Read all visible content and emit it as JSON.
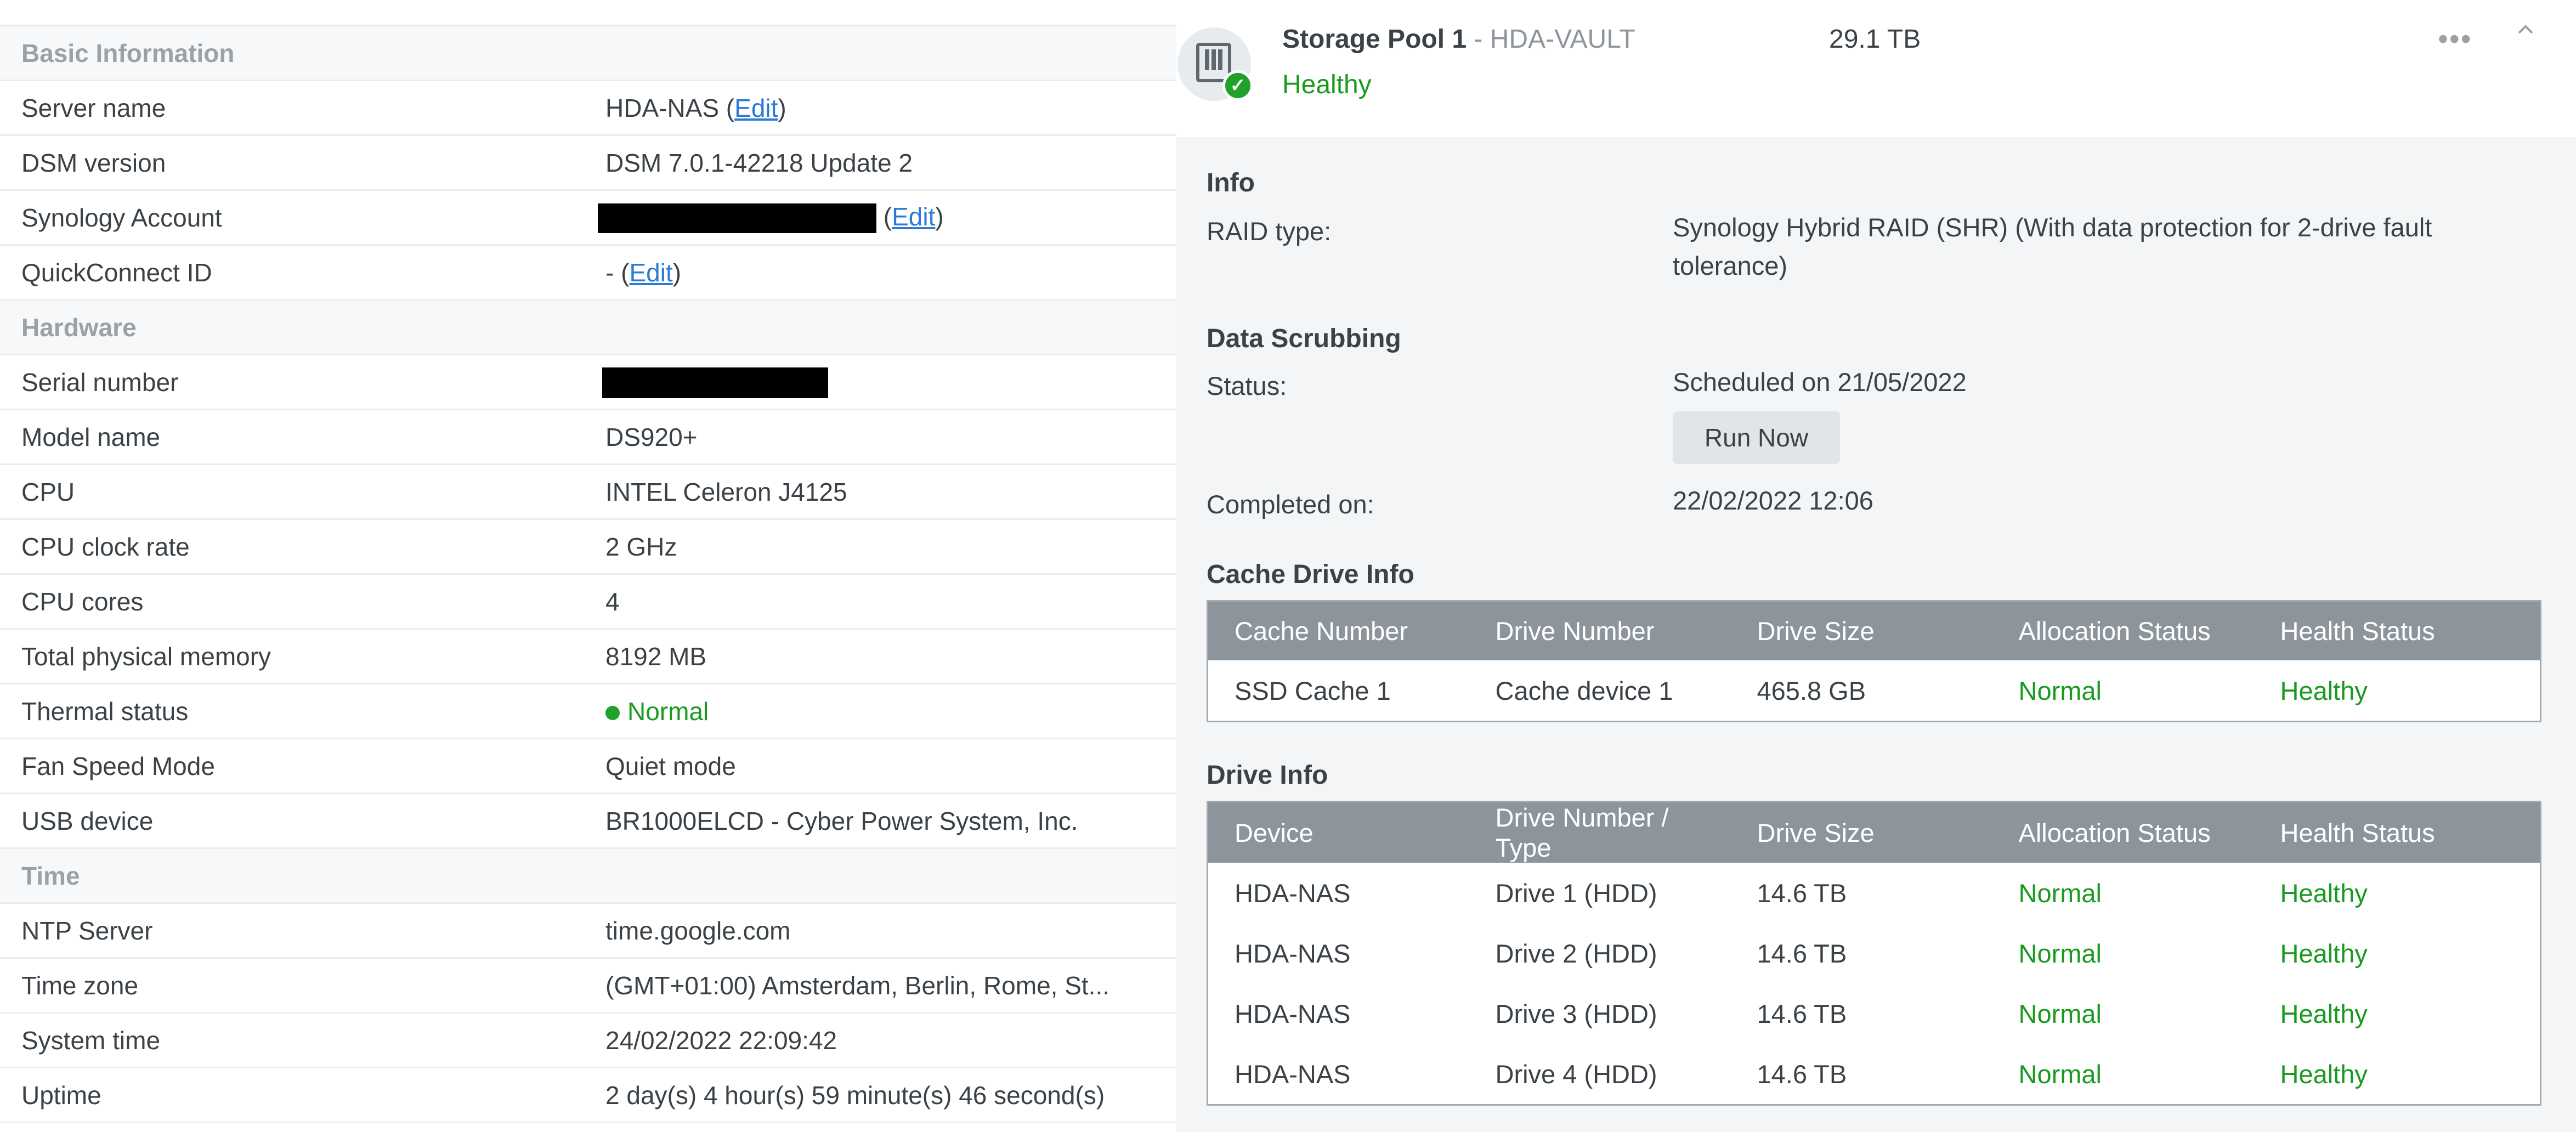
{
  "left_panel": {
    "sections": {
      "basic": "Basic Information",
      "hardware": "Hardware",
      "time": "Time"
    },
    "rows": {
      "server_name": {
        "label": "Server name",
        "value": "HDA-NAS",
        "edit": "Edit"
      },
      "dsm_version": {
        "label": "DSM version",
        "value": "DSM 7.0.1-42218 Update 2"
      },
      "synology_account": {
        "label": "Synology Account",
        "edit": "Edit"
      },
      "quickconnect": {
        "label": "QuickConnect ID",
        "value": "-",
        "edit": "Edit"
      },
      "serial": {
        "label": "Serial number"
      },
      "model": {
        "label": "Model name",
        "value": "DS920+"
      },
      "cpu": {
        "label": "CPU",
        "value": "INTEL Celeron J4125"
      },
      "cpu_clock": {
        "label": "CPU clock rate",
        "value": "2 GHz"
      },
      "cpu_cores": {
        "label": "CPU cores",
        "value": "4"
      },
      "memory": {
        "label": "Total physical memory",
        "value": "8192 MB"
      },
      "thermal": {
        "label": "Thermal status",
        "value": "Normal"
      },
      "fan": {
        "label": "Fan Speed Mode",
        "value": "Quiet mode"
      },
      "usb": {
        "label": "USB device",
        "value": "BR1000ELCD - Cyber Power System, Inc."
      },
      "ntp": {
        "label": "NTP Server",
        "value": "time.google.com"
      },
      "timezone": {
        "label": "Time zone",
        "value": "(GMT+01:00) Amsterdam, Berlin, Rome, St..."
      },
      "system_time": {
        "label": "System time",
        "value": "24/02/2022 22:09:42"
      },
      "uptime": {
        "label": "Uptime",
        "value": "2 day(s) 4 hour(s) 59 minute(s) 46 second(s)"
      }
    }
  },
  "storage_pool": {
    "name": "Storage Pool 1",
    "subtitle": " - HDA-VAULT",
    "size": "29.1 TB",
    "status": "Healthy",
    "icon": "storage-pool-icon",
    "info": {
      "heading": "Info",
      "raid_label": "RAID type:",
      "raid_value": "Synology Hybrid RAID (SHR) (With data protection for 2-drive fault tolerance)"
    },
    "scrubbing": {
      "heading": "Data Scrubbing",
      "status_label": "Status:",
      "status_value": "Scheduled on 21/05/2022",
      "run_now": "Run Now",
      "completed_label": "Completed on:",
      "completed_value": "22/02/2022 12:06"
    },
    "cache": {
      "heading": "Cache Drive Info",
      "columns": [
        "Cache Number",
        "Drive Number",
        "Drive Size",
        "Allocation Status",
        "Health Status"
      ],
      "rows": [
        [
          "SSD Cache 1",
          "Cache device 1",
          "465.8 GB",
          "Normal",
          "Healthy"
        ]
      ]
    },
    "drives": {
      "heading": "Drive Info",
      "columns": [
        "Device",
        "Drive Number / Type",
        "Drive Size",
        "Allocation Status",
        "Health Status"
      ],
      "rows": [
        [
          "HDA-NAS",
          "Drive 1 (HDD)",
          "14.6 TB",
          "Normal",
          "Healthy"
        ],
        [
          "HDA-NAS",
          "Drive 2 (HDD)",
          "14.6 TB",
          "Normal",
          "Healthy"
        ],
        [
          "HDA-NAS",
          "Drive 3 (HDD)",
          "14.6 TB",
          "Normal",
          "Healthy"
        ],
        [
          "HDA-NAS",
          "Drive 4 (HDD)",
          "14.6 TB",
          "Normal",
          "Healthy"
        ]
      ]
    }
  },
  "colors": {
    "healthy_green": "#1a9a20",
    "link_blue": "#2b7bd6",
    "table_header": "#8d959c"
  }
}
